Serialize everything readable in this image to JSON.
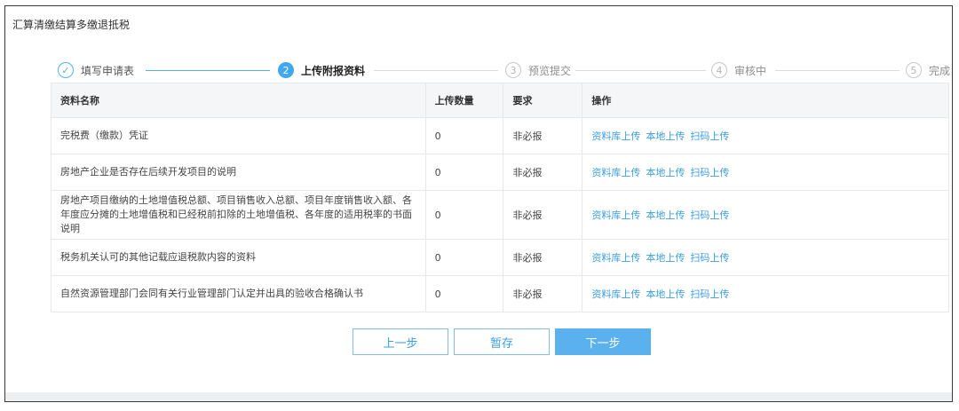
{
  "page": {
    "title": "汇算清缴结算多缴退抵税"
  },
  "steps": [
    {
      "label": "填写申请表",
      "number": "✓",
      "state": "done"
    },
    {
      "label": "上传附报资料",
      "number": "2",
      "state": "active"
    },
    {
      "label": "预览提交",
      "number": "3",
      "state": "pending"
    },
    {
      "label": "审核中",
      "number": "4",
      "state": "pending"
    },
    {
      "label": "完成",
      "number": "5",
      "state": "pending"
    }
  ],
  "table": {
    "headers": {
      "name": "资料名称",
      "count": "上传数量",
      "requirement": "要求",
      "ops": "操作"
    },
    "rows": [
      {
        "name": "完税费（缴款）凭证",
        "count": "0",
        "requirement": "非必报"
      },
      {
        "name": "房地产企业是否存在后续开发项目的说明",
        "count": "0",
        "requirement": "非必报"
      },
      {
        "name": "房地产项目缴纳的土地增值税总额、项目销售收入总额、项目年度销售收入额、各年度应分摊的土地增值税和已经税前扣除的土地增值税、各年度的适用税率的书面说明",
        "count": "0",
        "requirement": "非必报"
      },
      {
        "name": "税务机关认可的其他记载应退税款内容的资料",
        "count": "0",
        "requirement": "非必报"
      },
      {
        "name": "自然资源管理部门会同有关行业管理部门认定并出具的验收合格确认书",
        "count": "0",
        "requirement": "非必报"
      }
    ],
    "actions": {
      "library": "资料库上传",
      "local": "本地上传",
      "scan": "扫码上传"
    }
  },
  "buttons": {
    "prev": "上一步",
    "save": "暂存",
    "next": "下一步"
  }
}
